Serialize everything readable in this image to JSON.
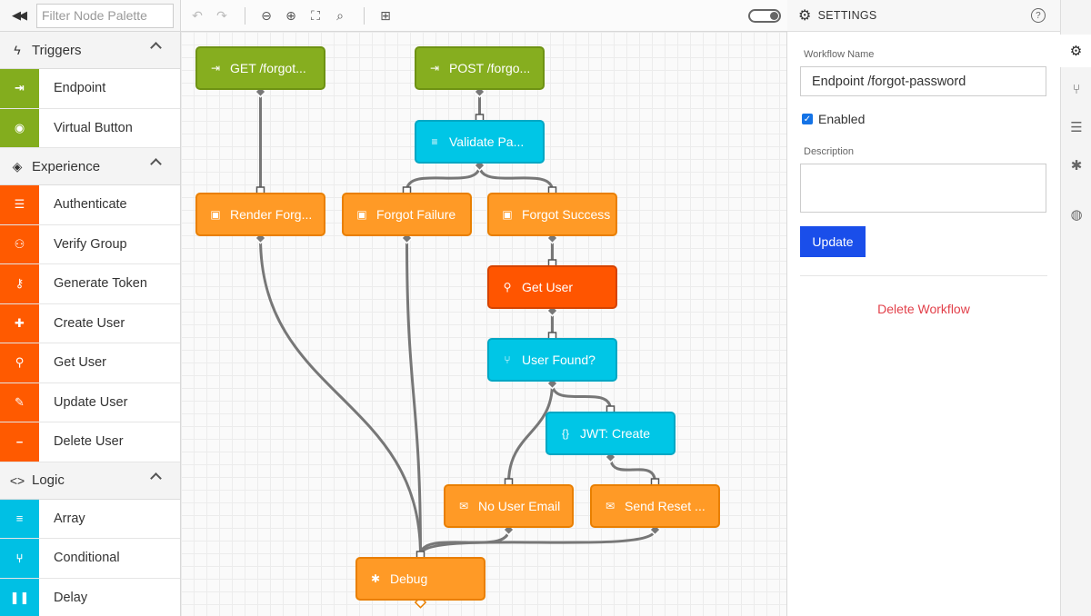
{
  "sidebar": {
    "collapse_glyph": "◀◀",
    "filter_placeholder": "Filter Node Palette",
    "categories": [
      {
        "label": "Triggers",
        "icon": "lightning-icon",
        "glyph": "ϟ",
        "color": "#83ad1e",
        "items": [
          {
            "label": "Endpoint",
            "icon": "endpoint-icon",
            "glyph": "⇥"
          },
          {
            "label": "Virtual Button",
            "icon": "virtual-button-icon",
            "glyph": "◉"
          }
        ]
      },
      {
        "label": "Experience",
        "icon": "experience-icon",
        "glyph": "◈",
        "color": "#ff5a00",
        "items": [
          {
            "label": "Authenticate",
            "icon": "fingerprint-icon",
            "glyph": "☰"
          },
          {
            "label": "Verify Group",
            "icon": "users-icon",
            "glyph": "⚇"
          },
          {
            "label": "Generate Token",
            "icon": "key-icon",
            "glyph": "⚷"
          },
          {
            "label": "Create User",
            "icon": "user-plus-icon",
            "glyph": "✚"
          },
          {
            "label": "Get User",
            "icon": "user-search-icon",
            "glyph": "⚲"
          },
          {
            "label": "Update User",
            "icon": "user-edit-icon",
            "glyph": "✎"
          },
          {
            "label": "Delete User",
            "icon": "user-minus-icon",
            "glyph": "−"
          }
        ]
      },
      {
        "label": "Logic",
        "icon": "code-icon",
        "glyph": "<>",
        "color": "#00c0e4",
        "items": [
          {
            "label": "Array",
            "icon": "list-icon",
            "glyph": "≡"
          },
          {
            "label": "Conditional",
            "icon": "branch-icon",
            "glyph": "⑂"
          },
          {
            "label": "Delay",
            "icon": "pause-icon",
            "glyph": "❚❚"
          }
        ]
      }
    ]
  },
  "toolbar": {
    "buttons": [
      {
        "name": "undo-icon",
        "glyph": "↶",
        "enabled": false
      },
      {
        "name": "redo-icon",
        "glyph": "↷",
        "enabled": false
      },
      {
        "name": "zoom-out-icon",
        "glyph": "⊖",
        "enabled": true
      },
      {
        "name": "zoom-in-icon",
        "glyph": "⊕",
        "enabled": true
      },
      {
        "name": "fit-screen-icon",
        "glyph": "⛶",
        "enabled": true
      },
      {
        "name": "zoom-reset-icon",
        "glyph": "⌕",
        "enabled": true
      },
      {
        "name": "add-node-icon",
        "glyph": "⊞",
        "enabled": true
      }
    ],
    "debug_toggle_on": false
  },
  "workflow": {
    "nodes": [
      {
        "id": "get",
        "label": "GET /forgot...",
        "color": "green",
        "icon": "endpoint-icon",
        "glyph": "⇥"
      },
      {
        "id": "post",
        "label": "POST /forgo...",
        "color": "green",
        "icon": "endpoint-icon",
        "glyph": "⇥"
      },
      {
        "id": "validate",
        "label": "Validate Pa...",
        "color": "cyan",
        "icon": "validate-icon",
        "glyph": "≡"
      },
      {
        "id": "render",
        "label": "Render Forg...",
        "color": "orange",
        "icon": "reply-icon",
        "glyph": "▣"
      },
      {
        "id": "failure",
        "label": "Forgot Failure",
        "color": "orange",
        "icon": "reply-icon",
        "glyph": "▣"
      },
      {
        "id": "success",
        "label": "Forgot Success",
        "color": "orange",
        "icon": "reply-icon",
        "glyph": "▣"
      },
      {
        "id": "getuser",
        "label": "Get User",
        "color": "dark",
        "icon": "user-search-icon",
        "glyph": "⚲"
      },
      {
        "id": "found",
        "label": "User Found?",
        "color": "cyan",
        "icon": "branch-icon",
        "glyph": "⑂"
      },
      {
        "id": "jwt",
        "label": "JWT: Create",
        "color": "cyan",
        "icon": "jwt-icon",
        "glyph": "{}"
      },
      {
        "id": "noemail",
        "label": "No User Email",
        "color": "orange",
        "icon": "email-icon",
        "glyph": "✉"
      },
      {
        "id": "sendreset",
        "label": "Send Reset ...",
        "color": "orange",
        "icon": "email-icon",
        "glyph": "✉"
      },
      {
        "id": "debug",
        "label": "Debug",
        "color": "orange",
        "icon": "bug-icon",
        "glyph": "✱"
      }
    ],
    "edges": [
      [
        "get",
        "render"
      ],
      [
        "post",
        "validate"
      ],
      [
        "validate",
        "failure"
      ],
      [
        "validate",
        "success"
      ],
      [
        "success",
        "getuser"
      ],
      [
        "getuser",
        "found"
      ],
      [
        "found",
        "noemail"
      ],
      [
        "found",
        "jwt"
      ],
      [
        "jwt",
        "sendreset"
      ],
      [
        "render",
        "debug"
      ],
      [
        "failure",
        "debug"
      ],
      [
        "noemail",
        "debug"
      ],
      [
        "sendreset",
        "debug"
      ]
    ]
  },
  "settings": {
    "title": "SETTINGS",
    "help_glyph": "?",
    "workflow_name_label": "Workflow Name",
    "workflow_name_value": "Endpoint /forgot-password",
    "enabled_label": "Enabled",
    "enabled": true,
    "description_label": "Description",
    "description_value": "",
    "update_label": "Update",
    "delete_label": "Delete Workflow"
  },
  "rail": [
    {
      "name": "settings-tab-icon",
      "glyph": "⚙",
      "active": true
    },
    {
      "name": "versions-tab-icon",
      "glyph": "⑂",
      "active": false
    },
    {
      "name": "storage-tab-icon",
      "glyph": "☰",
      "active": false
    },
    {
      "name": "debug-tab-icon",
      "glyph": "✱",
      "active": false
    },
    {
      "name": "globals-tab-icon",
      "glyph": "◍",
      "active": false
    }
  ],
  "colors": {
    "trigger_green": "#86ae1f",
    "experience_orange": "#ff9a26",
    "experience_dark": "#ff5500",
    "logic_cyan": "#00c6e6",
    "update_blue": "#1a4eea",
    "delete_red": "#e2404a"
  }
}
